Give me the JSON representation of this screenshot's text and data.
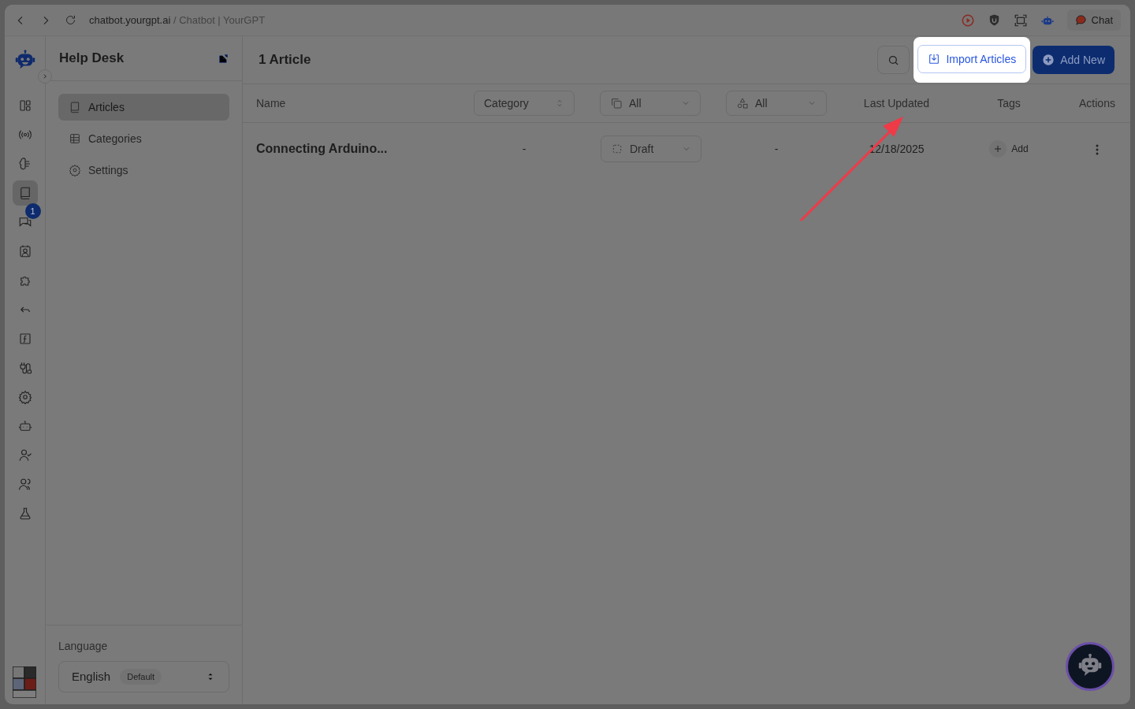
{
  "browser": {
    "domain": "chatbot.yourgpt.ai",
    "page_title": "/ Chatbot | YourGPT",
    "chat_button": "Chat"
  },
  "rail": {
    "items": [
      {
        "kind": "dashboard",
        "selected": false
      },
      {
        "kind": "broadcast",
        "selected": false
      },
      {
        "kind": "brain",
        "selected": false
      },
      {
        "kind": "book",
        "selected": true
      },
      {
        "kind": "chat",
        "selected": false,
        "badge": "1"
      },
      {
        "kind": "contact",
        "selected": false
      },
      {
        "kind": "puzzle",
        "selected": false
      },
      {
        "kind": "reply",
        "selected": false
      },
      {
        "kind": "function",
        "selected": false
      },
      {
        "kind": "plug",
        "selected": false
      },
      {
        "kind": "gear",
        "selected": false
      },
      {
        "kind": "bot",
        "selected": false
      },
      {
        "kind": "user-check",
        "selected": false
      },
      {
        "kind": "users",
        "selected": false
      },
      {
        "kind": "flask",
        "selected": false
      }
    ]
  },
  "sidebar": {
    "title": "Help Desk",
    "items": [
      {
        "label": "Articles",
        "kind": "book",
        "selected": true
      },
      {
        "label": "Categories",
        "kind": "grid",
        "selected": false
      },
      {
        "label": "Settings",
        "kind": "gear",
        "selected": false
      }
    ],
    "language": {
      "label": "Language",
      "value": "English",
      "badge": "Default"
    }
  },
  "main": {
    "title": "1 Article",
    "import_button": {
      "label": "Import Articles",
      "highlighted": true
    },
    "add_button": "Add New",
    "columns": [
      {
        "kind": "text",
        "label": "Name"
      },
      {
        "kind": "select",
        "label": "Category"
      },
      {
        "kind": "filter",
        "label": "All"
      },
      {
        "kind": "filter",
        "label": "All"
      },
      {
        "kind": "text",
        "label": "Last Updated"
      },
      {
        "kind": "text",
        "label": "Tags"
      },
      {
        "kind": "text",
        "label": "Actions"
      }
    ],
    "rows": [
      {
        "name": "Connecting Arduino...",
        "category": "-",
        "status": "Draft",
        "column_4": "-",
        "last_updated": "12/18/2025",
        "tags_button": "Add"
      }
    ]
  }
}
